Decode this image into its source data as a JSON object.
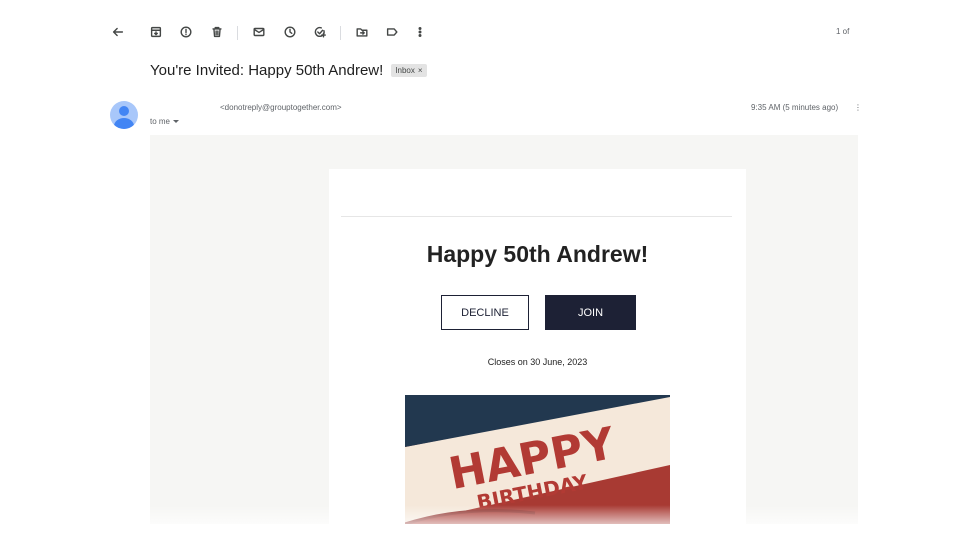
{
  "toolbar": {
    "icons": [
      "back-arrow-icon",
      "archive-icon",
      "report-spam-icon",
      "delete-icon",
      "mark-unread-icon",
      "snooze-icon",
      "add-task-icon",
      "move-to-icon",
      "label-icon",
      "more-vert-icon"
    ],
    "pager_text": "1 of"
  },
  "message": {
    "subject": "You're Invited: Happy 50th Andrew!",
    "label_chip": "Inbox",
    "chip_close": "×",
    "sender_email": "<donotreply@grouptogether.com>",
    "recipient": "to me",
    "time": "9:35 AM (5 minutes ago)"
  },
  "email_body": {
    "headline": "Happy 50th Andrew!",
    "decline_label": "DECLINE",
    "join_label": "JOIN",
    "closes_text": "Closes on 30 June, 2023",
    "banner_line1": "HAPPY",
    "banner_line2": "BIRTHDAY"
  },
  "colors": {
    "button_dark": "#1d2135",
    "banner_navy": "#22384f",
    "banner_cream": "#f5e8da",
    "banner_red": "#a83a33",
    "avatar_bg": "#a8c7fa",
    "avatar_fg": "#4285f4"
  }
}
